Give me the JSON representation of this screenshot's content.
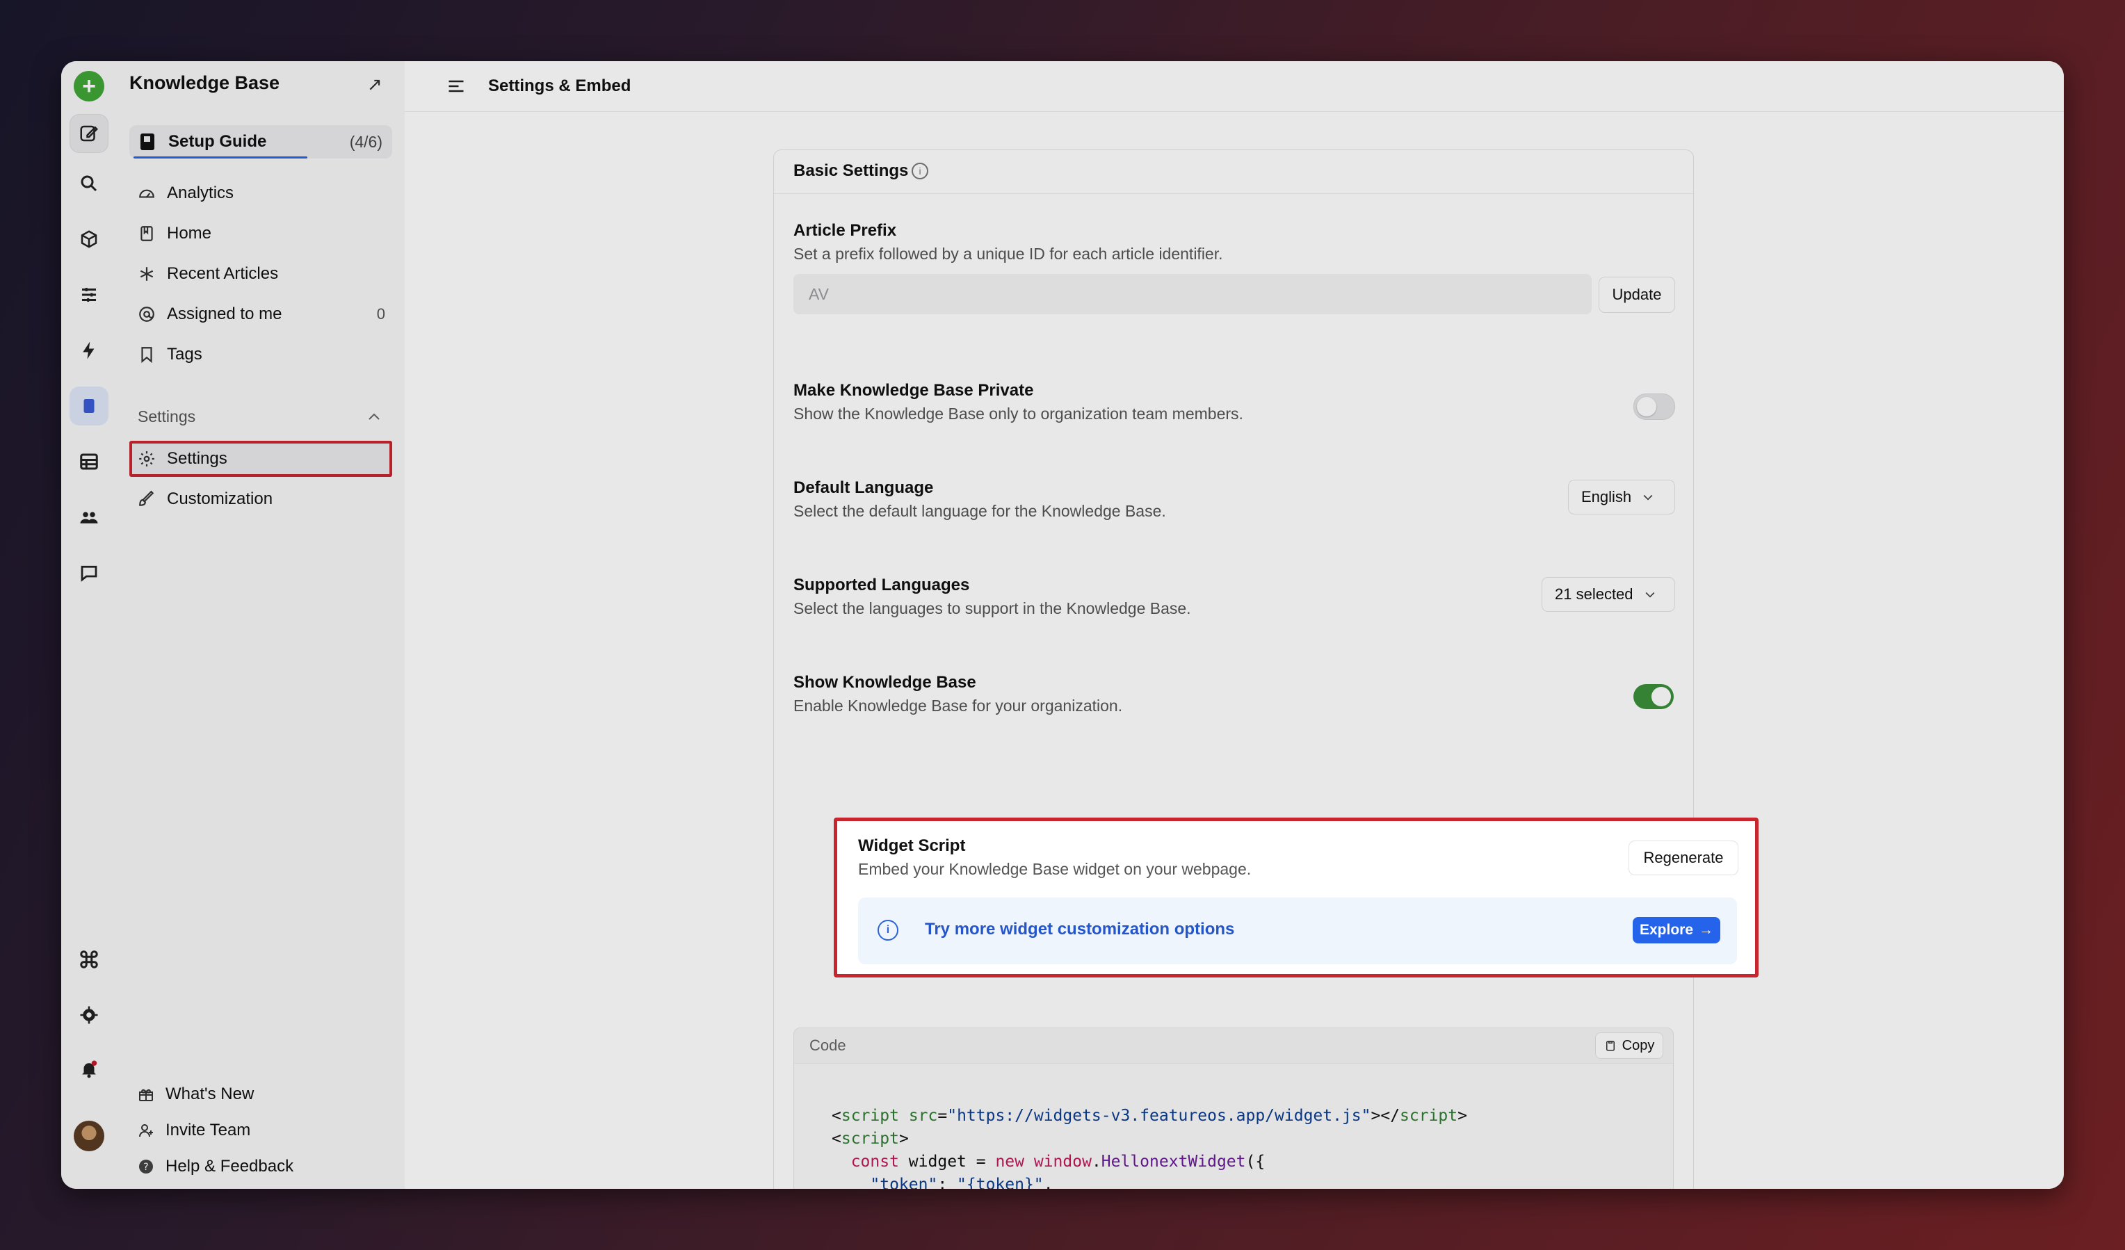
{
  "sidebar": {
    "title": "Knowledge Base",
    "setup_guide": {
      "label": "Setup Guide",
      "count": "(4/6)"
    },
    "nav": [
      {
        "label": "Analytics",
        "icon": "gauge-icon"
      },
      {
        "label": "Home",
        "icon": "book-icon"
      },
      {
        "label": "Recent Articles",
        "icon": "sparkle-icon"
      },
      {
        "label": "Assigned to me",
        "icon": "at-icon",
        "badge": "0"
      },
      {
        "label": "Tags",
        "icon": "bookmark-icon"
      }
    ],
    "settings_section": {
      "label": "Settings",
      "items": [
        {
          "label": "Settings",
          "icon": "gear-icon"
        },
        {
          "label": "Customization",
          "icon": "brush-icon"
        }
      ]
    },
    "footer": [
      {
        "label": "What's New",
        "icon": "gift-icon"
      },
      {
        "label": "Invite Team",
        "icon": "user-plus-icon"
      },
      {
        "label": "Help & Feedback",
        "icon": "help-icon"
      }
    ]
  },
  "topbar": {
    "title": "Settings & Embed"
  },
  "basic_settings": {
    "title": "Basic Settings",
    "article_prefix": {
      "title": "Article Prefix",
      "description": "Set a prefix followed by a unique ID for each article identifier.",
      "placeholder": "AV",
      "button": "Update"
    },
    "private": {
      "title": "Make Knowledge Base Private",
      "description": "Show the Knowledge Base only to organization team members.",
      "enabled": false
    },
    "default_language": {
      "title": "Default Language",
      "description": "Select the default language for the Knowledge Base.",
      "value": "English"
    },
    "supported_languages": {
      "title": "Supported Languages",
      "description": "Select the languages to support in the Knowledge Base.",
      "value": "21 selected"
    },
    "show_kb": {
      "title": "Show Knowledge Base",
      "description": "Enable Knowledge Base for your organization.",
      "enabled": true
    }
  },
  "widget_script": {
    "title": "Widget Script",
    "description": "Embed your Knowledge Base widget on your webpage.",
    "regenerate": "Regenerate",
    "callout": {
      "text": "Try more widget customization options",
      "button": "Explore",
      "button_arrow": "→"
    },
    "code_label": "Code",
    "copy_label": "Copy"
  },
  "colors": {
    "accent": "#2563eb",
    "highlight": "#c7262f",
    "toggle_on": "#3b8f3a",
    "notification": "#c11b2a"
  }
}
